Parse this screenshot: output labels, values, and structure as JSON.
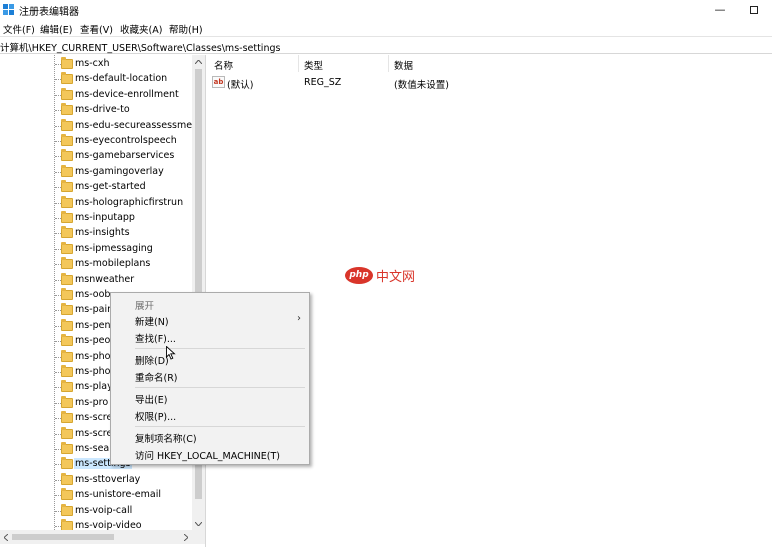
{
  "window": {
    "title": "注册表编辑器",
    "minimize_glyph": "—"
  },
  "menu": {
    "items": [
      "文件(F)",
      "编辑(E)",
      "查看(V)",
      "收藏夹(A)",
      "帮助(H)"
    ]
  },
  "address": {
    "path": "计算机\\HKEY_CURRENT_USER\\Software\\Classes\\ms-settings"
  },
  "tree": {
    "items": [
      "ms-cxh",
      "ms-default-location",
      "ms-device-enrollment",
      "ms-drive-to",
      "ms-edu-secureassessment",
      "ms-eyecontrolspeech",
      "ms-gamebarservices",
      "ms-gamingoverlay",
      "ms-get-started",
      "ms-holographicfirstrun",
      "ms-inputapp",
      "ms-insights",
      "ms-ipmessaging",
      "ms-mobileplans",
      "msnweather",
      "ms-oob",
      "ms-pair",
      "ms-pen",
      "ms-peo",
      "ms-pho",
      "ms-pho",
      "ms-play",
      "ms-pro",
      "ms-scre",
      "ms-scre",
      "ms-sear",
      "ms-settings",
      "ms-sttoverlay",
      "ms-unistore-email",
      "ms-voip-call",
      "ms-voip-video"
    ],
    "selected_index": 26
  },
  "list": {
    "columns": [
      "名称",
      "类型",
      "数据"
    ],
    "rows": [
      {
        "name": "(默认)",
        "type": "REG_SZ",
        "data": "(数值未设置)"
      }
    ]
  },
  "context_menu": {
    "items": [
      {
        "label": "展开",
        "disabled": true
      },
      {
        "label": "新建(N)",
        "submenu": true
      },
      {
        "label": "查找(F)..."
      },
      {
        "label": "删除(D)"
      },
      {
        "label": "重命名(R)"
      },
      {
        "label": "导出(E)"
      },
      {
        "label": "权限(P)..."
      },
      {
        "label": "复制项名称(C)"
      },
      {
        "label": "访问 HKEY_LOCAL_MACHINE(T)"
      }
    ]
  },
  "watermark": {
    "badge": "php",
    "text": "中文网"
  },
  "colors": {
    "selection": "#cce8ff",
    "folder": "#f3c75a",
    "watermark": "#d9352a"
  }
}
